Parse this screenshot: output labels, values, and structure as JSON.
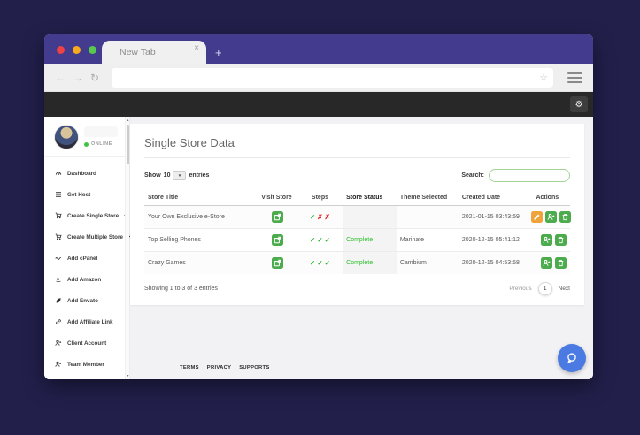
{
  "window": {
    "tab_title": "New Tab"
  },
  "browser_chrome": {
    "back_glyph": "←",
    "forward_glyph": "→",
    "reload_glyph": "↻",
    "star_glyph": "☆",
    "url_value": ""
  },
  "app_header": {
    "gear_glyph": "⚙"
  },
  "sidebar": {
    "online_status": "ONLINE",
    "items": [
      {
        "label": "Dashboard",
        "icon": "dashboard-icon",
        "has_plus": false
      },
      {
        "label": "Get Host",
        "icon": "server-icon",
        "has_plus": false
      },
      {
        "label": "Create Single Store",
        "icon": "cart-icon",
        "has_plus": true
      },
      {
        "label": "Create Multiple Store",
        "icon": "cart-icon",
        "has_plus": true
      },
      {
        "label": "Add cPanel",
        "icon": "cpanel-icon",
        "has_plus": false
      },
      {
        "label": "Add Amazon",
        "icon": "amazon-icon",
        "has_plus": false
      },
      {
        "label": "Add Envato",
        "icon": "envato-icon",
        "has_plus": false
      },
      {
        "label": "Add Affiliate Link",
        "icon": "link-icon",
        "has_plus": false
      },
      {
        "label": "Client Account",
        "icon": "user-plus-icon",
        "has_plus": false
      },
      {
        "label": "Team Member",
        "icon": "user-plus-icon",
        "has_plus": false
      }
    ]
  },
  "main": {
    "title": "Single Store Data",
    "length_control": {
      "show_label": "Show",
      "value": "10",
      "entries_label": "entries"
    },
    "search": {
      "label": "Search:",
      "value": ""
    },
    "table": {
      "headers": [
        "Store Title",
        "Visit Store",
        "Steps",
        "Store Status",
        "Theme Selected",
        "Created Date",
        "Actions"
      ],
      "sorted_column": "Store Status",
      "rows": [
        {
          "title": "Your Own Exclusive e-Store",
          "visit": true,
          "steps": [
            "check",
            "cross",
            "cross"
          ],
          "status": "",
          "theme": "",
          "created": "2021-01-15 03:43:59",
          "actions": [
            "edit",
            "assign",
            "delete"
          ]
        },
        {
          "title": "Top Selling Phones",
          "visit": true,
          "steps": [
            "check",
            "check",
            "check"
          ],
          "status": "Complete",
          "theme": "Marinate",
          "created": "2020-12-15 05:41:12",
          "actions": [
            "assign",
            "delete"
          ]
        },
        {
          "title": "Crazy Games",
          "visit": true,
          "steps": [
            "check",
            "check",
            "check"
          ],
          "status": "Complete",
          "theme": "Cambium",
          "created": "2020-12-15 04:53:58",
          "actions": [
            "assign",
            "delete"
          ]
        }
      ],
      "info": "Showing 1 to 3 of 3 entries",
      "pagination": {
        "previous": "Previous",
        "current_page": "1",
        "next": "Next"
      }
    },
    "footer_links": [
      "TERMS",
      "PRIVACY",
      "SUPPORTS"
    ]
  },
  "glyphs": {
    "check": "✓",
    "cross": "✗",
    "plus": "+",
    "close": "×",
    "select_chevron": "▾",
    "scroll_up": "▴",
    "scroll_down": "▾"
  },
  "colors": {
    "outer_background": "#221f4b",
    "accent_purple": "#423b8e",
    "toolbar_dark": "#282828",
    "success_green": "#4cab4c",
    "warning_orange": "#f0a33a",
    "status_complete_green": "#30c130",
    "error_red": "#e02020",
    "online_green": "#44c244",
    "search_border_green": "#a4d394",
    "fab_blue": "#4a7ae2",
    "traffic_red": "#ee4245",
    "traffic_yellow": "#fbaa1d",
    "traffic_green": "#56c94e"
  }
}
